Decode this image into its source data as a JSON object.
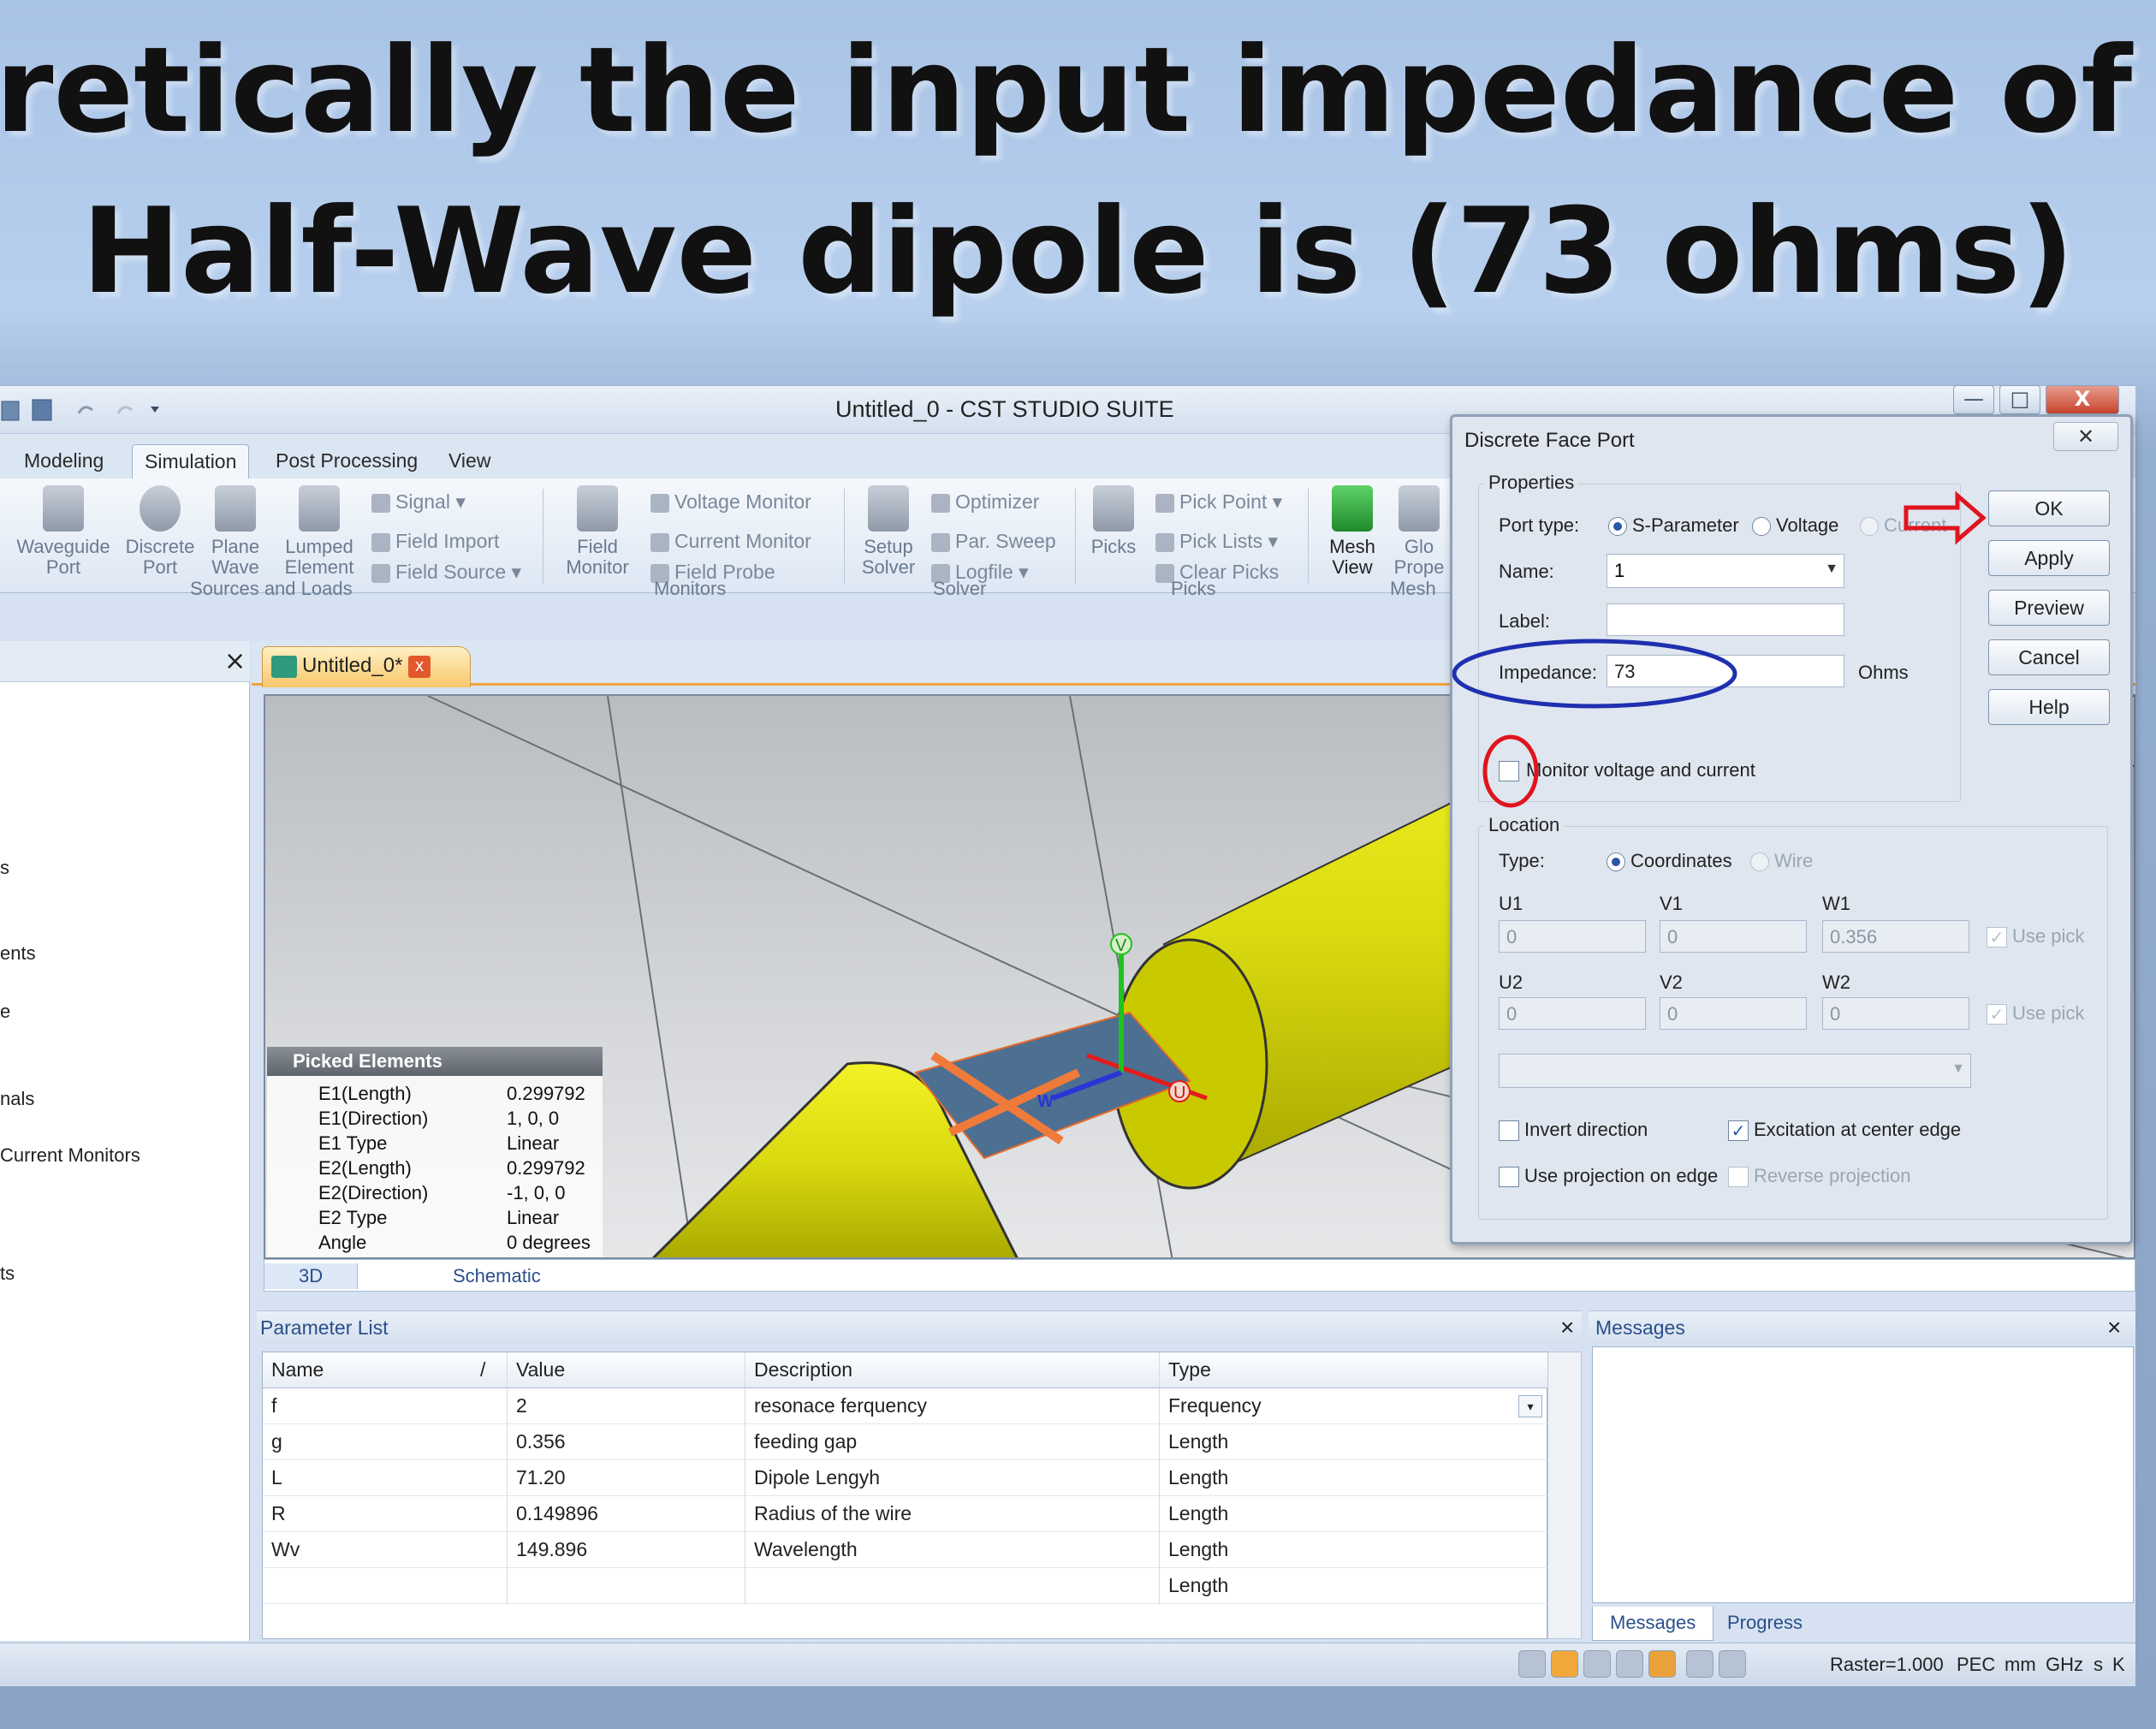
{
  "slide": {
    "title_line1": "heoretically the input impedance of",
    "title_line2": "Half-Wave dipole is (73 ohms)"
  },
  "app": {
    "window_title": "Untitled_0 - CST STUDIO SUITE",
    "window_buttons": {
      "minimize": "—",
      "restore": "□",
      "close": "X"
    },
    "tabs": [
      "Modeling",
      "Simulation",
      "Post Processing",
      "View"
    ],
    "active_tab": "Simulation",
    "ribbon": {
      "waveguide_port": "Waveguide\nPort",
      "discrete_port": "Discrete\nPort",
      "plane_wave": "Plane\nWave",
      "lumped_element": "Lumped\nElement",
      "signal": "Signal",
      "field_import": "Field Import",
      "field_source": "Field Source",
      "group_sources": "Sources and Loads",
      "field_monitor": "Field\nMonitor",
      "voltage_monitor": "Voltage Monitor",
      "current_monitor": "Current Monitor",
      "field_probe": "Field Probe",
      "group_monitors": "Monitors",
      "setup_solver": "Setup\nSolver",
      "optimizer": "Optimizer",
      "par_sweep": "Par. Sweep",
      "logfile": "Logfile",
      "group_solver": "Solver",
      "picks": "Picks",
      "pick_point": "Pick Point",
      "pick_lists": "Pick Lists",
      "clear_picks": "Clear Picks",
      "group_picks": "Picks",
      "mesh_view": "Mesh\nView",
      "global_props": "Glo\nPrope",
      "group_mesh": "Mesh"
    },
    "nav_close": "×",
    "nav_items": [
      "s",
      "ents",
      "e",
      "nals",
      "Current Monitors",
      "ts"
    ],
    "doc_tab": "Untitled_0*",
    "doc_tab_close": "x",
    "view_tabs": [
      "3D",
      "Schematic"
    ],
    "picked_elements": {
      "title": "Picked Elements",
      "rows": [
        {
          "k": "E1(Length)",
          "v": "0.299792"
        },
        {
          "k": "E1(Direction)",
          "v": "1, 0, 0"
        },
        {
          "k": "E1 Type",
          "v": "Linear"
        },
        {
          "k": "E2(Length)",
          "v": "0.299792"
        },
        {
          "k": "E2(Direction)",
          "v": "-1, 0, 0"
        },
        {
          "k": "E2 Type",
          "v": "Linear"
        },
        {
          "k": "Angle",
          "v": "0 degrees"
        }
      ]
    },
    "axis_labels": {
      "v": "V",
      "w": "W",
      "u": "U"
    },
    "parameter_list": {
      "title": "Parameter List",
      "close": "×",
      "headers": [
        "Name",
        "/",
        "Value",
        "Description",
        "Type"
      ],
      "rows": [
        {
          "name": "f",
          "value": "2",
          "description": "resonace ferquency",
          "type": "Frequency"
        },
        {
          "name": "g",
          "value": "0.356",
          "description": "feeding gap",
          "type": "Length"
        },
        {
          "name": "L",
          "value": "71.20",
          "description": "Dipole Lengyh",
          "type": "Length"
        },
        {
          "name": "R",
          "value": "0.149896",
          "description": "Radius of the wire",
          "type": "Length"
        },
        {
          "name": "Wv",
          "value": "149.896",
          "description": "Wavelength",
          "type": "Length"
        },
        {
          "name": "",
          "value": "",
          "description": "",
          "type": "Length"
        }
      ]
    },
    "messages": {
      "title": "Messages",
      "close": "×",
      "tabs": [
        "Messages",
        "Progress"
      ]
    },
    "status": {
      "raster": "Raster=1.000",
      "pec": "PEC",
      "mm": "mm",
      "ghz": "GHz",
      "s": "s",
      "k": "K"
    }
  },
  "dialog": {
    "title": "Discrete Face Port",
    "close": "✕",
    "properties_label": "Properties",
    "port_type_label": "Port type:",
    "port_types": [
      "S-Parameter",
      "Voltage",
      "Current"
    ],
    "name_label": "Name:",
    "name_value": "1",
    "label_label": "Label:",
    "label_value": "",
    "impedance_label": "Impedance:",
    "impedance_value": "73",
    "impedance_unit": "Ohms",
    "monitor_label": "Monitor voltage and current",
    "location_label": "Location",
    "type_label": "Type:",
    "location_types": [
      "Coordinates",
      "Wire"
    ],
    "coords": {
      "u1": "U1",
      "v1": "V1",
      "w1": "W1",
      "u1_val": "0",
      "v1_val": "0",
      "w1_val": "0.356",
      "u2": "U2",
      "v2": "V2",
      "w2": "W2",
      "u2_val": "0",
      "v2_val": "0",
      "w2_val": "0",
      "use_pick": "Use pick"
    },
    "invert_direction": "Invert direction",
    "excitation_center": "Excitation at center edge",
    "use_projection": "Use projection on edge",
    "reverse_projection": "Reverse projection",
    "buttons": {
      "ok": "OK",
      "apply": "Apply",
      "preview": "Preview",
      "cancel": "Cancel",
      "help": "Help"
    },
    "annotation_colors": {
      "blue_ellipse": "#1f2fb0",
      "red_circle": "#e0141e",
      "red_arrow": "#e0141e"
    }
  }
}
